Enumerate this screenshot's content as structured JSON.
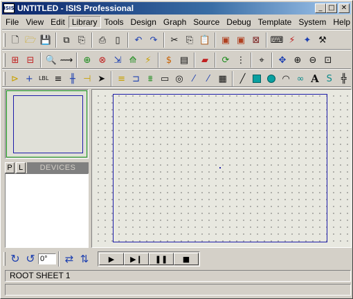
{
  "window": {
    "title": "UNTITLED - ISIS Professional",
    "app_icon_label": "ISIS",
    "minimize": "_",
    "maximize": "□",
    "close": "✕"
  },
  "menu": {
    "items": [
      "File",
      "View",
      "Edit",
      "Library",
      "Tools",
      "Design",
      "Graph",
      "Source",
      "Debug",
      "Template",
      "System",
      "Help"
    ],
    "active": "Library"
  },
  "toolbar_icons": {
    "row1": [
      "new-file-icon",
      "open-folder-icon",
      "save-icon",
      "import-section-icon",
      "export-section-icon",
      "print-icon",
      "print-area-icon",
      "undo-icon",
      "redo-icon",
      "cut-icon",
      "copy-icon",
      "paste-icon",
      "block-copy-icon",
      "block-move-icon",
      "block-delete-icon",
      "pick-device-icon",
      "make-device-icon",
      "package-tool-icon",
      "decompose-icon"
    ],
    "row2": [
      "design-explorer-icon",
      "new-sheet-icon",
      "search-icon",
      "wire-autorouter-icon",
      "add-sheet-icon",
      "remove-sheet-icon",
      "goto-sheet-icon",
      "property-assign-icon",
      "bill-of-materials-icon",
      "netlist-icon",
      "ares-icon",
      "refresh-icon",
      "grid-icon",
      "origin-icon",
      "pan-icon",
      "zoom-in-icon",
      "zoom-out-icon",
      "zoom-area-icon",
      "zoom-all-icon"
    ],
    "row3": [
      "select-mode-icon",
      "component-mode-icon",
      "junction-dot-icon",
      "wire-label-icon",
      "text-script-icon",
      "bus-icon",
      "subcircuit-icon",
      "terminal-icon",
      "pin-icon",
      "graph-icon",
      "tape-icon",
      "generator-icon",
      "voltage-probe-icon",
      "current-probe-icon",
      "virtual-instrument-icon",
      "line-icon",
      "box-icon",
      "circle-icon",
      "arc-icon",
      "path-icon",
      "text-icon",
      "symbol-icon",
      "marker-icon"
    ]
  },
  "left_panel": {
    "tab_p": "P",
    "tab_l": "L",
    "devices_title": "DEVICES"
  },
  "bottom": {
    "rotate_cw_icon": "rotate-clockwise-icon",
    "rotate_ccw_icon": "rotate-anticlockwise-icon",
    "angle_value": "0°",
    "mirror_x_icon": "mirror-horizontal-icon",
    "mirror_y_icon": "mirror-vertical-icon",
    "sim_buttons": [
      "▶",
      "▶❙",
      "❚❚",
      "■"
    ]
  },
  "status": {
    "sheet": "ROOT SHEET 1",
    "message": ""
  },
  "colors": {
    "title_bar": "#0a246a",
    "sheet_border": "#1a1aa8",
    "overview_frame": "#20a020",
    "grid_dots": "#606060"
  }
}
